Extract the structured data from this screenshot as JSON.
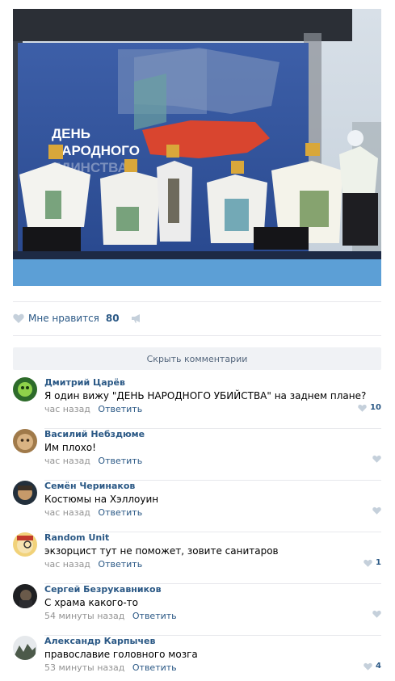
{
  "post": {
    "photo_banner_line1": "ДЕНЬ",
    "photo_banner_line2": "НАРОДНОГО",
    "photo_banner_line3": "ЕДИНСТВА",
    "like_label": "Мне нравится",
    "like_count": "80",
    "hide_comments_label": "Скрыть комментарии"
  },
  "comments": [
    {
      "author": "Дмитрий Царёв",
      "text": "Я один вижу \"ДЕНЬ НАРОДНОГО УБИЙСТВА\" на заднем плане?",
      "time": "час назад",
      "reply": "Ответить",
      "likes": "10"
    },
    {
      "author": "Василий Небздюме",
      "text": "Им плохо!",
      "time": "час назад",
      "reply": "Ответить",
      "likes": ""
    },
    {
      "author": "Семён Черинаков",
      "text": "Костюмы на Хэллоуин",
      "time": "час назад",
      "reply": "Ответить",
      "likes": ""
    },
    {
      "author": "Random Unit",
      "text": "экзорцист тут не поможет, зовите санитаров",
      "time": "час назад",
      "reply": "Ответить",
      "likes": "1"
    },
    {
      "author": "Сергей Безрукавников",
      "text": "С храма какого-то",
      "time": "54 минуты назад",
      "reply": "Ответить",
      "likes": ""
    },
    {
      "author": "Александр Карпычев",
      "text": "православие головного мозга",
      "time": "53 минуты назад",
      "reply": "Ответить",
      "likes": "4"
    }
  ],
  "colors": {
    "link": "#2a5885",
    "muted": "#939393",
    "heart": "#c5d0db"
  }
}
